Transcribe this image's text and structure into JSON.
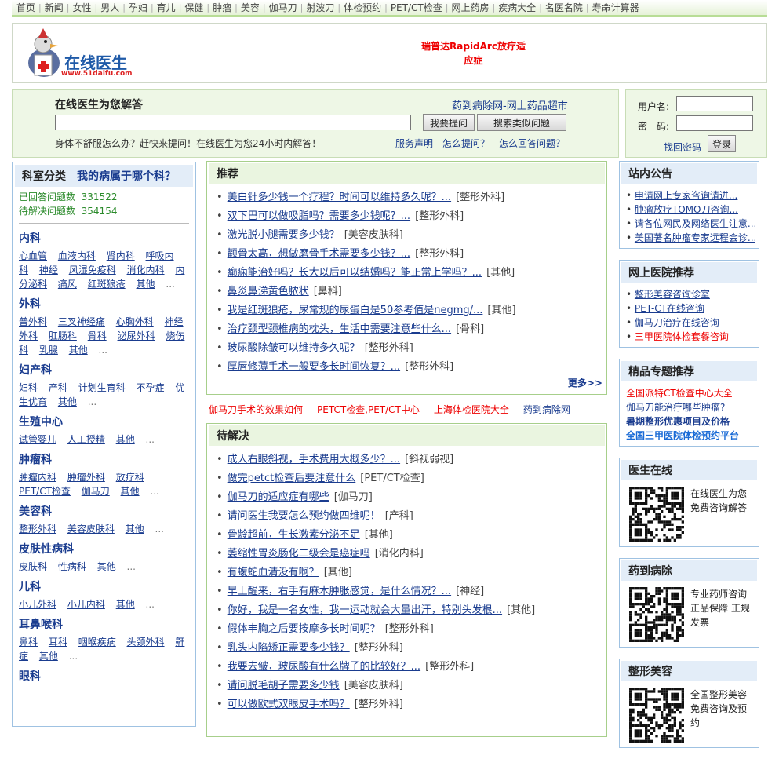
{
  "topnav": [
    "首页",
    "新闻",
    "女性",
    "男人",
    "孕妇",
    "育儿",
    "保健",
    "肿瘤",
    "美容",
    "伽马刀",
    "射波刀",
    "体检预约",
    "PET/CT检查",
    "网上药房",
    "疾病大全",
    "名医名院",
    "寿命计算器"
  ],
  "header": {
    "logo_text": "在线医生",
    "logo_url": "www.51daifu.com",
    "ad_text": "瑞普达RapidArc放疗适应症"
  },
  "ask": {
    "title": "在线医生为您解答",
    "pharmacy_link": "药到病除网-网上药品超市",
    "input_value": "",
    "btn_ask": "我要提问",
    "btn_search": "搜索类似问题",
    "hint": "身体不舒服怎么办？赶快来提问！在线医生为您24小时内解答！",
    "link_service": "服务声明",
    "link_how_ask": "怎么提问？",
    "link_how_answer": "怎么回答问题？"
  },
  "login": {
    "user_label": "用户名:",
    "pass_label": "密　码:",
    "forgot": "找回密码",
    "btn": "登录"
  },
  "left": {
    "title": "科室分类",
    "my_dept": "我的病属于哪个科？",
    "answered_label": "已回答问题数",
    "answered_count": "331522",
    "pending_label": "待解决问题数",
    "pending_count": "354154",
    "categories": [
      {
        "title": "内科",
        "links": [
          "心血管",
          "血液内科",
          "肾内科",
          "呼吸内科",
          "神经",
          "风湿免疫科",
          "消化内科",
          "内分泌科",
          "痛风",
          "红斑狼疮",
          "其他"
        ]
      },
      {
        "title": "外科",
        "links": [
          "普外科",
          "三叉神经痛",
          "心胸外科",
          "神经外科",
          "肛肠科",
          "骨科",
          "泌尿外科",
          "烧伤科",
          "乳腺",
          "其他"
        ]
      },
      {
        "title": "妇产科",
        "links": [
          "妇科",
          "产科",
          "计划生育科",
          "不孕症",
          "优生优育",
          "其他"
        ]
      },
      {
        "title": "生殖中心",
        "links": [
          "试管婴儿",
          "人工授精",
          "其他"
        ]
      },
      {
        "title": "肿瘤科",
        "links": [
          "肿瘤内科",
          "肿瘤外科",
          "放疗科",
          "PET/CT检查",
          "伽马刀",
          "其他"
        ]
      },
      {
        "title": "美容科",
        "links": [
          "整形外科",
          "美容皮肤科",
          "其他"
        ]
      },
      {
        "title": "皮肤性病科",
        "links": [
          "皮肤科",
          "性病科",
          "其他"
        ]
      },
      {
        "title": "儿科",
        "links": [
          "小儿外科",
          "小儿内科",
          "其他"
        ]
      },
      {
        "title": "耳鼻喉科",
        "links": [
          "鼻科",
          "耳科",
          "咽喉疾病",
          "头颈外科",
          "鼾症",
          "其他"
        ]
      },
      {
        "title": "眼科",
        "links": []
      }
    ],
    "dots": "..."
  },
  "recommend": {
    "title": "推荐",
    "items": [
      {
        "q": "美白针多少钱一个疗程？时间可以维持多久呢？...",
        "tag": "[整形外科]"
      },
      {
        "q": "双下巴可以做吸脂吗？需要多少钱呢？...",
        "tag": "[整形外科]"
      },
      {
        "q": "激光脱小腿需要多少钱？",
        "tag": "[美容皮肤科]"
      },
      {
        "q": "颧骨太高，想做磨骨手术需要多少钱？...",
        "tag": "[整形外科]"
      },
      {
        "q": "癫痫能治好吗？长大以后可以结婚吗？能正常上学吗？...",
        "tag": "[其他]"
      },
      {
        "q": "鼻炎鼻涕黄色脓状",
        "tag": "[鼻科]"
      },
      {
        "q": "我是红斑狼疮，尿常规的尿蛋白是50参考值是negmg/...",
        "tag": "[其他]"
      },
      {
        "q": "治疗颈型颈椎病的枕头，生活中需要注意些什么...",
        "tag": "[骨科]"
      },
      {
        "q": "玻尿酸除皱可以维持多久呢？",
        "tag": "[整形外科]"
      },
      {
        "q": "厚唇修薄手术一般要多长时间恢复？...",
        "tag": "[整形外科]"
      }
    ],
    "more": "更多>>"
  },
  "redlinks": [
    "伽马刀手术的效果如何",
    "PETCT检查,PET/CT中心",
    "上海体检医院大全",
    "药到病除网"
  ],
  "pending": {
    "title": "待解决",
    "items": [
      {
        "q": "成人右眼斜视，手术费用大概多少？...",
        "tag": "[斜视弱视]"
      },
      {
        "q": "做完petct检查后要注意什么",
        "tag": "[PET/CT检查]"
      },
      {
        "q": "伽马刀的适应症有哪些",
        "tag": "[伽马刀]"
      },
      {
        "q": "请问医生我要怎么预约做四维呢！",
        "tag": "[产科]"
      },
      {
        "q": "骨龄超前，生长激素分泌不足",
        "tag": "[其他]"
      },
      {
        "q": "萎缩性胃炎肠化二级会是癌症吗",
        "tag": "[消化内科]"
      },
      {
        "q": "有蝮蛇血清没有啊？",
        "tag": "[其他]"
      },
      {
        "q": "早上醒来，右手有麻木肿胀感觉，是什么情况？...",
        "tag": "[神经]"
      },
      {
        "q": "你好，我是一名女性，我一运动就会大量出汗，特别头发根...",
        "tag": "[其他]"
      },
      {
        "q": "假体丰胸之后要按摩多长时间呢？",
        "tag": "[整形外科]"
      },
      {
        "q": "乳头内陷矫正需要多少钱？",
        "tag": "[整形外科]"
      },
      {
        "q": "我要去皱，玻尿酸有什么牌子的比较好？...",
        "tag": "[整形外科]"
      },
      {
        "q": "请问脱毛胡子需要多少钱",
        "tag": "[美容皮肤科]"
      },
      {
        "q": "可以做欧式双眼皮手术吗？",
        "tag": "[整形外科]"
      }
    ]
  },
  "notice": {
    "title": "站内公告",
    "items": [
      "申请网上专家咨询请进...",
      "肿瘤放疗TOMO刀咨询...",
      "请各位网民及网络医生注意...",
      "美国著名肿瘤专家远程会诊..."
    ]
  },
  "hospital": {
    "title": "网上医院推荐",
    "items": [
      "整形美容咨询诊室",
      "PET-CT在线咨询",
      "伽马刀治疗在线咨询",
      "三甲医院体检套餐咨询"
    ]
  },
  "premium": {
    "title": "精品专题推荐",
    "items": [
      "全国派特CT检查中心大全",
      "伽马刀能治疗哪些肿瘤?",
      "暑期整形优惠项目及价格",
      "全国三甲医院体检预约平台"
    ]
  },
  "doctor_online": {
    "title": "医生在线",
    "text": "在线医生为您免费咨询解答"
  },
  "yaodao": {
    "title": "药到病除",
    "text": "专业药师咨询正品保障 正规发票"
  },
  "cosmetic": {
    "title": "整形美容",
    "text": "全国整形美容免费咨询及预约"
  },
  "colors": {
    "link": "#1a3c8f",
    "red": "#e00",
    "green_panel": "#eaf5e0",
    "blue_panel": "#e3edf8"
  }
}
